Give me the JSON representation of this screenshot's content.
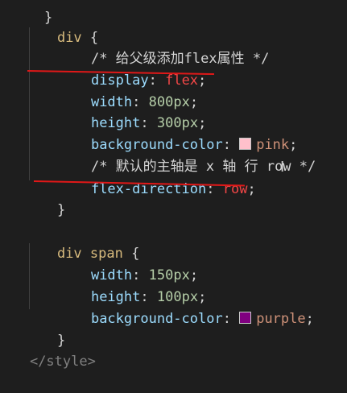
{
  "code": {
    "rule1": {
      "selector": "div",
      "open_brace": "{",
      "comment1": "/* 给父级添加flex属性 */",
      "decls": [
        {
          "prop": "display",
          "value": "flex"
        },
        {
          "prop": "width",
          "num": "800",
          "unit": "px"
        },
        {
          "prop": "height",
          "num": "300",
          "unit": "px"
        },
        {
          "prop": "background-color",
          "value": "pink",
          "swatch": "#ffc0cb"
        }
      ],
      "comment2": "/* 默认的主轴是 x 轴 行 row */",
      "decl_direction": {
        "prop": "flex-direction",
        "value": "row"
      },
      "close_brace": "}"
    },
    "rule2": {
      "selector": "div span",
      "open_brace": "{",
      "decls": [
        {
          "prop": "width",
          "num": "150",
          "unit": "px"
        },
        {
          "prop": "height",
          "num": "100",
          "unit": "px"
        },
        {
          "prop": "background-color",
          "value": "purple",
          "swatch": "#800080"
        }
      ],
      "close_brace": "}"
    },
    "closing_tag": "</style>"
  },
  "annotations": {
    "underline_color": "#e01818"
  },
  "cursor_glyph": "I"
}
